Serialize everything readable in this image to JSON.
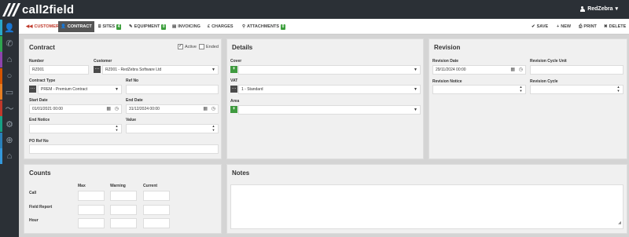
{
  "app": {
    "name": "call2field",
    "user": "RedZebra"
  },
  "sidebar": {
    "items": [
      {
        "name": "person-icon",
        "glyph": "👤",
        "color": "#2aa7c9"
      },
      {
        "name": "phone-icon",
        "glyph": "✆",
        "color": "#2ea44f"
      },
      {
        "name": "tag-icon",
        "glyph": "⌂",
        "color": "#8e44ad"
      },
      {
        "name": "chat-icon",
        "glyph": "○",
        "color": "#d35400"
      },
      {
        "name": "folder-icon",
        "glyph": "▭",
        "color": "#e67e22"
      },
      {
        "name": "trend-icon",
        "glyph": "〜",
        "color": "#c0392b"
      },
      {
        "name": "gear-icon",
        "glyph": "⚙",
        "color": "#16a085"
      },
      {
        "name": "crosshair-icon",
        "glyph": "⊕",
        "color": "#2980b9"
      },
      {
        "name": "home-icon",
        "glyph": "⌂",
        "color": "#3498db"
      }
    ]
  },
  "toolbar": {
    "tabs": [
      {
        "label": "CUSTOMER",
        "icon": "◀◀"
      },
      {
        "label": "CONTRACT",
        "icon": "👤"
      },
      {
        "label": "SITES",
        "icon": "⌸",
        "badge": "4"
      },
      {
        "label": "EQUIPMENT",
        "icon": "✎",
        "badge": "0"
      },
      {
        "label": "INVOICING",
        "icon": "▤"
      },
      {
        "label": "CHARGES",
        "icon": "£"
      },
      {
        "label": "ATTACHMENTS",
        "icon": "⚲",
        "badge": "0"
      }
    ],
    "actions": [
      {
        "label": "SAVE",
        "icon": "✔"
      },
      {
        "label": "NEW",
        "icon": "+"
      },
      {
        "label": "PRINT",
        "icon": "⎙"
      },
      {
        "label": "DELETE",
        "icon": "✖"
      }
    ]
  },
  "contract": {
    "title": "Contract",
    "active_label": "Active",
    "active_checked": true,
    "ended_label": "Ended",
    "ended_checked": false,
    "number_label": "Number",
    "number_value": "RZ001",
    "customer_label": "Customer",
    "customer_value": "RZ001 - RedZebra Software Ltd",
    "contract_type_label": "Contract Type",
    "contract_type_value": "PREM - Premium Contract",
    "ref_no_label": "Ref No",
    "ref_no_value": "",
    "start_date_label": "Start Date",
    "start_date_value": "01/01/2021 00:00",
    "end_date_label": "End Date",
    "end_date_value": "31/12/2024 00:00",
    "end_notice_label": "End Notice",
    "end_notice_value": "",
    "value_label": "Value",
    "value_value": "",
    "po_ref_label": "PO Ref No",
    "po_ref_value": ""
  },
  "details": {
    "title": "Details",
    "cover_label": "Cover",
    "cover_value": "",
    "vat_label": "VAT",
    "vat_value": "1 - Standard",
    "area_label": "Area",
    "area_value": ""
  },
  "revision": {
    "title": "Revision",
    "revision_date_label": "Revision Date",
    "revision_date_value": "29/11/2024 00:00",
    "cycle_unit_label": "Revision Cycle Unit",
    "cycle_unit_value": "",
    "notice_label": "Revision Notice",
    "notice_value": "",
    "cycle_label": "Revision Cycle",
    "cycle_value": ""
  },
  "counts": {
    "title": "Counts",
    "columns": [
      "Max",
      "Warning",
      "Current"
    ],
    "rows": [
      "Call",
      "Field Report",
      "Hour"
    ]
  },
  "notes": {
    "title": "Notes",
    "value": ""
  }
}
